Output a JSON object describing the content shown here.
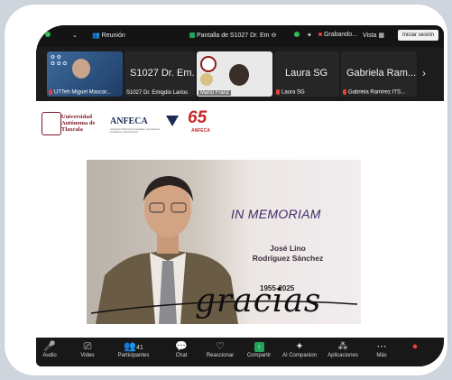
{
  "topbar": {
    "meeting_label": "Reunión",
    "screen_share_label": "Pantalla de S1027 Dr. Em",
    "recording_label": "Grabando...",
    "view_label": "Vista",
    "signin_label": "Iniciar sesión"
  },
  "participants": [
    {
      "name": "UTTeh Miguel Mascar..."
    },
    {
      "big_name": "S1027 Dr. Em...",
      "name": "S1027 Dr. Emigdio Larios"
    },
    {
      "name": "Mario Franz"
    },
    {
      "big_name": "Laura SG",
      "name": "Laura SG"
    },
    {
      "big_name": "Gabriela Ram...",
      "name": "Gabriela Ramírez ITS..."
    }
  ],
  "slide": {
    "university_logo_text": "Universidad Autónoma de Tlaxcala",
    "anfeca_text": "ANFECA",
    "anfeca_sub": "Asociación Nacional de Facultades y Escuelas de Contaduría y Administración",
    "anniversary_text": "65",
    "anniversary_sub": "ANFECA",
    "in_memoriam": "IN MEMORIAM",
    "name_line1": "José Lino",
    "name_line2": "Rodríguez Sánchez",
    "years": "1955-2025",
    "gracias": "gracias"
  },
  "toolbar": {
    "audio": "Audio",
    "video": "Video",
    "participants": "Participantes",
    "participants_count": "41",
    "chat": "Chat",
    "react": "Reaccionar",
    "share": "Compartir",
    "ai": "AI Companion",
    "apps": "Aplicaciones",
    "more": "Más"
  },
  "colors": {
    "recording": "#e5403a",
    "share_green": "#22a35a",
    "security_green": "#2ebd59"
  }
}
